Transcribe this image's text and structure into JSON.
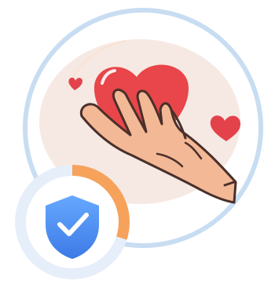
{
  "illustration": {
    "subject": "hand-holding-heart",
    "badge": {
      "icon": "shield-check-icon",
      "progress_fraction": 0.3
    }
  },
  "colors": {
    "outer_ring": "#c8ddf2",
    "inner_fill": "#f1f6fc",
    "oval_bg": "#f6e9e3",
    "heart": "#e8464a",
    "heart_shine": "#ffffff",
    "hand_skin": "#f3b895",
    "hand_outline": "#4a2f2a",
    "small_heart": "#e3424a",
    "badge_ring_track": "#e6eefa",
    "badge_ring_progress": "#f6a25a",
    "badge_inner": "#ffffff",
    "shield_top": "#66a8ff",
    "shield_bottom": "#3d7ae6",
    "check": "#ffffff"
  }
}
